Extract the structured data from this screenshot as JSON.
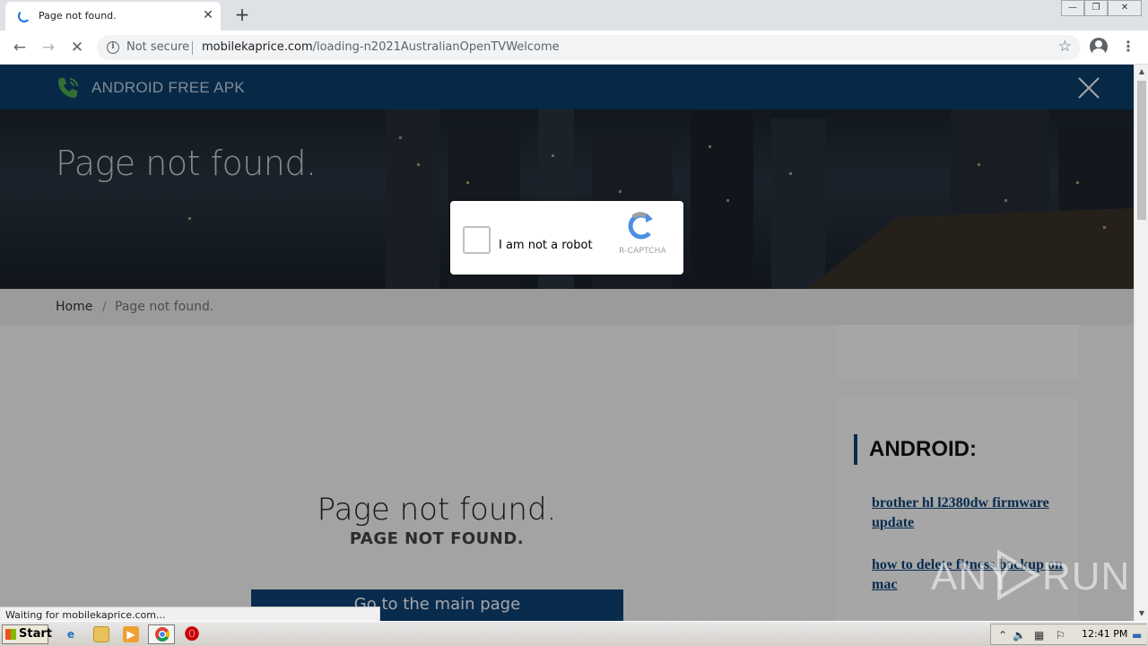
{
  "browser": {
    "tab_title": "Page not found.",
    "tab_close": "✕",
    "new_tab": "+",
    "security_label": "Not secure",
    "url_host": "mobilekaprice.com",
    "url_path": "/loading-n2021AustralianOpenTVWelcome",
    "status_text": "Waiting for mobilekaprice.com..."
  },
  "site": {
    "brand": "ANDROID FREE APK",
    "hero_title": "Page not found.",
    "breadcrumb": {
      "home": "Home",
      "separator": "/",
      "current": "Page not found."
    },
    "error_title": "Page not found.",
    "error_subtitle": "PAGE NOT FOUND.",
    "main_button": "Go to the main page",
    "sidebar": {
      "heading": "ANDROID:",
      "links": [
        "brother hl l2380dw firmware update",
        "how to delete fitness backup on mac"
      ]
    }
  },
  "captcha": {
    "label": "I am not a robot",
    "brand": "R-CAPTCHA"
  },
  "watermark": {
    "left": "ANY",
    "right": "RUN"
  },
  "taskbar": {
    "start_label": "Start",
    "clock": "12:41 PM"
  },
  "colors": {
    "header_bg": "#0c3f6e",
    "accent": "#0d4278",
    "captcha_blue": "#4a90e2"
  },
  "icons": [
    "back-arrow-icon",
    "forward-arrow-icon",
    "stop-icon",
    "info-icon",
    "star-icon",
    "account-icon",
    "menu-icon",
    "phone-icon",
    "close-icon",
    "recaptcha-icon",
    "windows-flag-icon",
    "ie-icon",
    "folder-icon",
    "media-player-icon",
    "chrome-icon",
    "opera-icon"
  ]
}
